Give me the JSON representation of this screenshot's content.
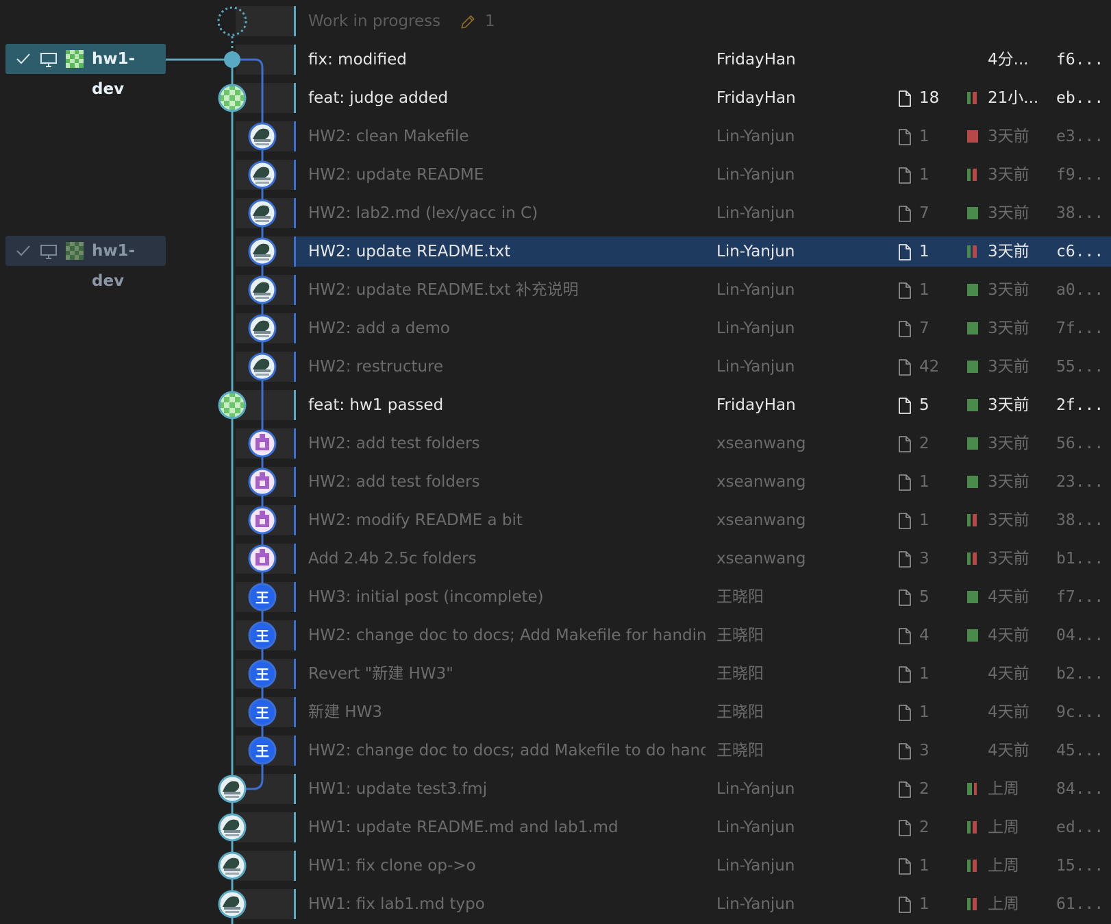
{
  "wip": {
    "label": "Work in progress",
    "count": "1"
  },
  "branches": [
    {
      "name": "hw1-dev",
      "state": "active"
    },
    {
      "name": "hw1-dev",
      "state": "inactive"
    }
  ],
  "colors": {
    "added": "#4a8a4a",
    "deleted": "#b84848",
    "lane_main": "#5aa9c2",
    "lane_side": "#3b6fd6",
    "selected_row": "#1e3a5f",
    "avatar_purple": "#a65fc9",
    "avatar_blue": "#2563eb"
  },
  "commits": [
    {
      "message": "fix: modified",
      "author": "FridayHan",
      "files": "",
      "date": "4分...",
      "hash": "f6...",
      "bright": true,
      "lane": "main",
      "avatar": "none",
      "change": []
    },
    {
      "message": "feat: judge added",
      "author": "FridayHan",
      "files": "18",
      "date": "21小...",
      "hash": "eb...",
      "bright": true,
      "lane": "main",
      "avatar": "checker-green",
      "change": [
        0.5,
        0.5
      ]
    },
    {
      "message": "HW2: clean Makefile",
      "author": "Lin-Yanjun",
      "files": "1",
      "date": "3天前",
      "hash": "e3...",
      "bright": false,
      "lane": "side",
      "avatar": "photo",
      "change": [
        0,
        1
      ]
    },
    {
      "message": "HW2: update README",
      "author": "Lin-Yanjun",
      "files": "1",
      "date": "3天前",
      "hash": "f9...",
      "bright": false,
      "lane": "side",
      "avatar": "photo",
      "change": [
        0.5,
        0.5
      ]
    },
    {
      "message": "HW2: lab2.md (lex/yacc in C)",
      "author": "Lin-Yanjun",
      "files": "7",
      "date": "3天前",
      "hash": "38...",
      "bright": false,
      "lane": "side",
      "avatar": "photo",
      "change": [
        1,
        0
      ]
    },
    {
      "message": "HW2: update README.txt",
      "author": "Lin-Yanjun",
      "files": "1",
      "date": "3天前",
      "hash": "c6...",
      "bright": true,
      "selected": true,
      "lane": "side",
      "avatar": "photo",
      "change": [
        0.5,
        0.5
      ]
    },
    {
      "message": "HW2: update README.txt 补充说明",
      "author": "Lin-Yanjun",
      "files": "1",
      "date": "3天前",
      "hash": "a0...",
      "bright": false,
      "lane": "side",
      "avatar": "photo",
      "change": [
        1,
        0
      ]
    },
    {
      "message": "HW2: add a demo",
      "author": "Lin-Yanjun",
      "files": "7",
      "date": "3天前",
      "hash": "7f...",
      "bright": false,
      "lane": "side",
      "avatar": "photo",
      "change": [
        1,
        0
      ]
    },
    {
      "message": "HW2: restructure",
      "author": "Lin-Yanjun",
      "files": "42",
      "date": "3天前",
      "hash": "55...",
      "bright": false,
      "lane": "side",
      "avatar": "photo",
      "change": [
        1,
        0
      ]
    },
    {
      "message": "feat: hw1 passed",
      "author": "FridayHan",
      "files": "5",
      "date": "3天前",
      "hash": "2f...",
      "bright": true,
      "lane": "main",
      "avatar": "checker-green",
      "change": [
        1,
        0
      ]
    },
    {
      "message": "HW2: add test folders",
      "author": "xseanwang",
      "files": "2",
      "date": "3天前",
      "hash": "56...",
      "bright": false,
      "lane": "side",
      "avatar": "purple",
      "change": [
        1,
        0
      ]
    },
    {
      "message": "HW2: add test folders",
      "author": "xseanwang",
      "files": "1",
      "date": "3天前",
      "hash": "23...",
      "bright": false,
      "lane": "side",
      "avatar": "purple",
      "change": [
        1,
        0
      ]
    },
    {
      "message": "HW2: modify README a bit",
      "author": "xseanwang",
      "files": "1",
      "date": "3天前",
      "hash": "38...",
      "bright": false,
      "lane": "side",
      "avatar": "purple",
      "change": [
        0.5,
        0.5
      ]
    },
    {
      "message": "Add 2.4b 2.5c folders",
      "author": "xseanwang",
      "files": "3",
      "date": "3天前",
      "hash": "b1...",
      "bright": false,
      "lane": "side",
      "avatar": "purple",
      "change": [
        0.5,
        0.5
      ]
    },
    {
      "message": "HW3: initial post (incomplete)",
      "author": "王晓阳",
      "files": "5",
      "date": "4天前",
      "hash": "f7...",
      "bright": false,
      "lane": "side",
      "avatar": "wang",
      "avatar_text": "王",
      "change": [
        1,
        0
      ]
    },
    {
      "message": "HW2: change doc to docs; Add Makefile for handin",
      "author": "王晓阳",
      "files": "4",
      "date": "4天前",
      "hash": "04...",
      "bright": false,
      "lane": "side",
      "avatar": "wang",
      "avatar_text": "王",
      "change": [
        1,
        0
      ]
    },
    {
      "message": "Revert \"新建 HW3\"",
      "author": "王晓阳",
      "files": "1",
      "date": "4天前",
      "hash": "b2...",
      "bright": false,
      "lane": "side",
      "avatar": "wang",
      "avatar_text": "王",
      "change": []
    },
    {
      "message": "新建 HW3",
      "author": "王晓阳",
      "files": "1",
      "date": "4天前",
      "hash": "9c...",
      "bright": false,
      "lane": "side",
      "avatar": "wang",
      "avatar_text": "王",
      "change": []
    },
    {
      "message": "HW2: change doc to docs; add Makefile to do hand",
      "author": "王晓阳",
      "files": "3",
      "date": "4天前",
      "hash": "45...",
      "bright": false,
      "lane": "side",
      "avatar": "wang",
      "avatar_text": "王",
      "change": []
    },
    {
      "message": "HW1: update test3.fmj",
      "author": "Lin-Yanjun",
      "files": "2",
      "date": "上周",
      "hash": "84...",
      "bright": false,
      "lane": "main",
      "avatar": "photo",
      "change": [
        0.6,
        0.4
      ]
    },
    {
      "message": "HW1: update README.md and lab1.md",
      "author": "Lin-Yanjun",
      "files": "2",
      "date": "上周",
      "hash": "ed...",
      "bright": false,
      "lane": "main",
      "avatar": "photo",
      "change": [
        0.5,
        0.5
      ]
    },
    {
      "message": "HW1: fix clone op->o",
      "author": "Lin-Yanjun",
      "files": "1",
      "date": "上周",
      "hash": "15...",
      "bright": false,
      "lane": "main",
      "avatar": "photo",
      "change": [
        0.5,
        0.5
      ]
    },
    {
      "message": "HW1: fix lab1.md typo",
      "author": "Lin-Yanjun",
      "files": "1",
      "date": "上周",
      "hash": "61...",
      "bright": false,
      "lane": "main",
      "avatar": "photo",
      "change": [
        0.5,
        0.5
      ]
    }
  ]
}
